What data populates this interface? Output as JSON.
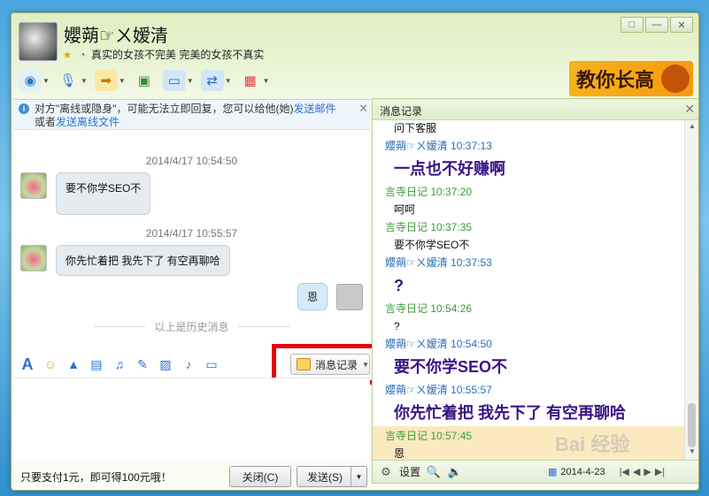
{
  "window": {
    "contact_name": "孆蒴☞ㄨ嫒清",
    "signature": "真实的女孩不完美 完美的女孩不真实",
    "ad_text": "教你长高",
    "win_controls": [
      "□",
      "—",
      "✕"
    ]
  },
  "toolbar": {
    "icons": [
      "video-icon",
      "mic-icon",
      "file-transfer-icon",
      "app-icon",
      "remote-desktop-icon",
      "share-icon",
      "apps-grid-icon"
    ]
  },
  "notice": {
    "text1": "对方\"离线或隐身\"，可能无法立即回复，您可以给他(她)",
    "link1": "发送邮件",
    "text2": "或者",
    "link2": "发送离线文件"
  },
  "chat": {
    "ts1": "2014/4/17 10:54:50",
    "msg1": "要不你学SEO不",
    "ts2": "2014/4/17 10:55:57",
    "msg2": "你先忙着把 我先下了 有空再聊哈",
    "my_msg": "恩",
    "history_divider": "以上是历史消息"
  },
  "input_toolbar": {
    "history_button": "消息记录"
  },
  "footer": {
    "promo": "只要支付1元，即可得100元哦！",
    "close_button": "关闭(C)",
    "send_button": "发送(S)"
  },
  "history_pane": {
    "title": "消息记录",
    "entries": [
      {
        "type": "body-small",
        "text": "问下客服"
      },
      {
        "type": "hdr-purple",
        "text": "孆蒴☞ㄨ嫒清 10:37:13"
      },
      {
        "type": "body-big",
        "text": "一点也不好赚啊"
      },
      {
        "type": "hdr-green",
        "text": "言寺日记 10:37:20"
      },
      {
        "type": "body-small",
        "text": "呵呵"
      },
      {
        "type": "hdr-green",
        "text": "言寺日记 10:37:35"
      },
      {
        "type": "body-small",
        "text": "要不你学SEO不"
      },
      {
        "type": "hdr-purple",
        "text": "孆蒴☞ㄨ嫒清 10:37:53"
      },
      {
        "type": "body-big",
        "text": "?"
      },
      {
        "type": "hdr-green",
        "text": "言寺日记 10:54:26"
      },
      {
        "type": "body-small",
        "text": "?"
      },
      {
        "type": "hdr-purple",
        "text": "孆蒴☞ㄨ嫒清 10:54:50"
      },
      {
        "type": "body-big",
        "text": "要不你学SEO不"
      },
      {
        "type": "hdr-purple",
        "text": "孆蒴☞ㄨ嫒清 10:55:57"
      },
      {
        "type": "body-big",
        "text": "你先忙着把 我先下了 有空再聊哈"
      },
      {
        "type": "hdr-green",
        "text": "言寺日记 10:57:45",
        "highlight": true
      },
      {
        "type": "body-small",
        "text": "恩",
        "highlight": true
      }
    ],
    "settings_label": "设置",
    "date": "2014-4-23"
  }
}
